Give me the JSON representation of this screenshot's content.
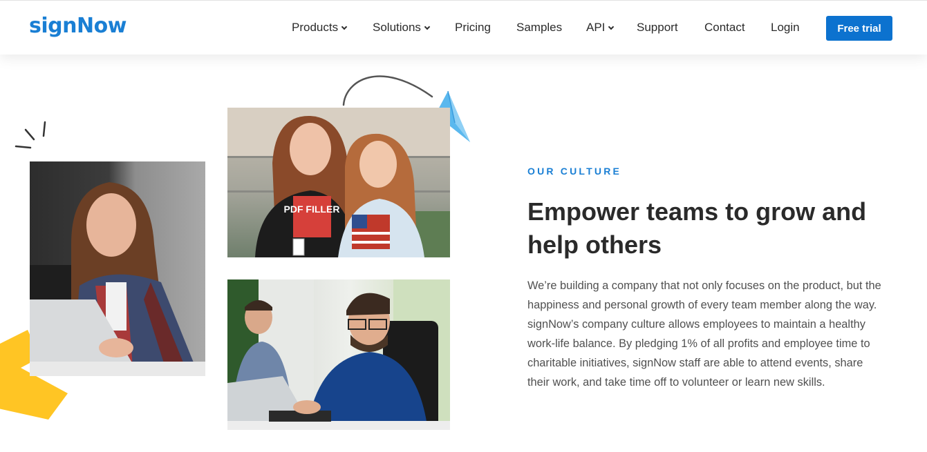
{
  "header": {
    "logo": "signNow",
    "nav": [
      {
        "label": "Products",
        "dropdown": true
      },
      {
        "label": "Solutions",
        "dropdown": true
      },
      {
        "label": "Pricing",
        "dropdown": false
      },
      {
        "label": "Samples",
        "dropdown": false
      },
      {
        "label": "API",
        "dropdown": true
      },
      {
        "label": "Support",
        "dropdown": false
      },
      {
        "label": "Contact",
        "dropdown": false
      },
      {
        "label": "Login",
        "dropdown": false
      }
    ],
    "cta_label": "Free trial"
  },
  "section": {
    "eyebrow": "OUR CULTURE",
    "headline": "Empower teams to grow and help others",
    "body": "We’re building a company that not only focuses on the product, but the happiness and personal growth of every team member along the way. signNow’s company culture allows employees to maintain a healthy work-life balance. By pledging 1% of all profits and employee time to charitable initiatives, signNow staff are able to attend events, share their work, and take time off to volunteer or learn new skills."
  },
  "photos": {
    "tshirt_text": "PDF FILLER"
  },
  "colors": {
    "brand": "#1a7fd4",
    "cta": "#0c72cf",
    "accent_yellow": "#ffc524",
    "accent_plane": "#5ab8ee"
  }
}
